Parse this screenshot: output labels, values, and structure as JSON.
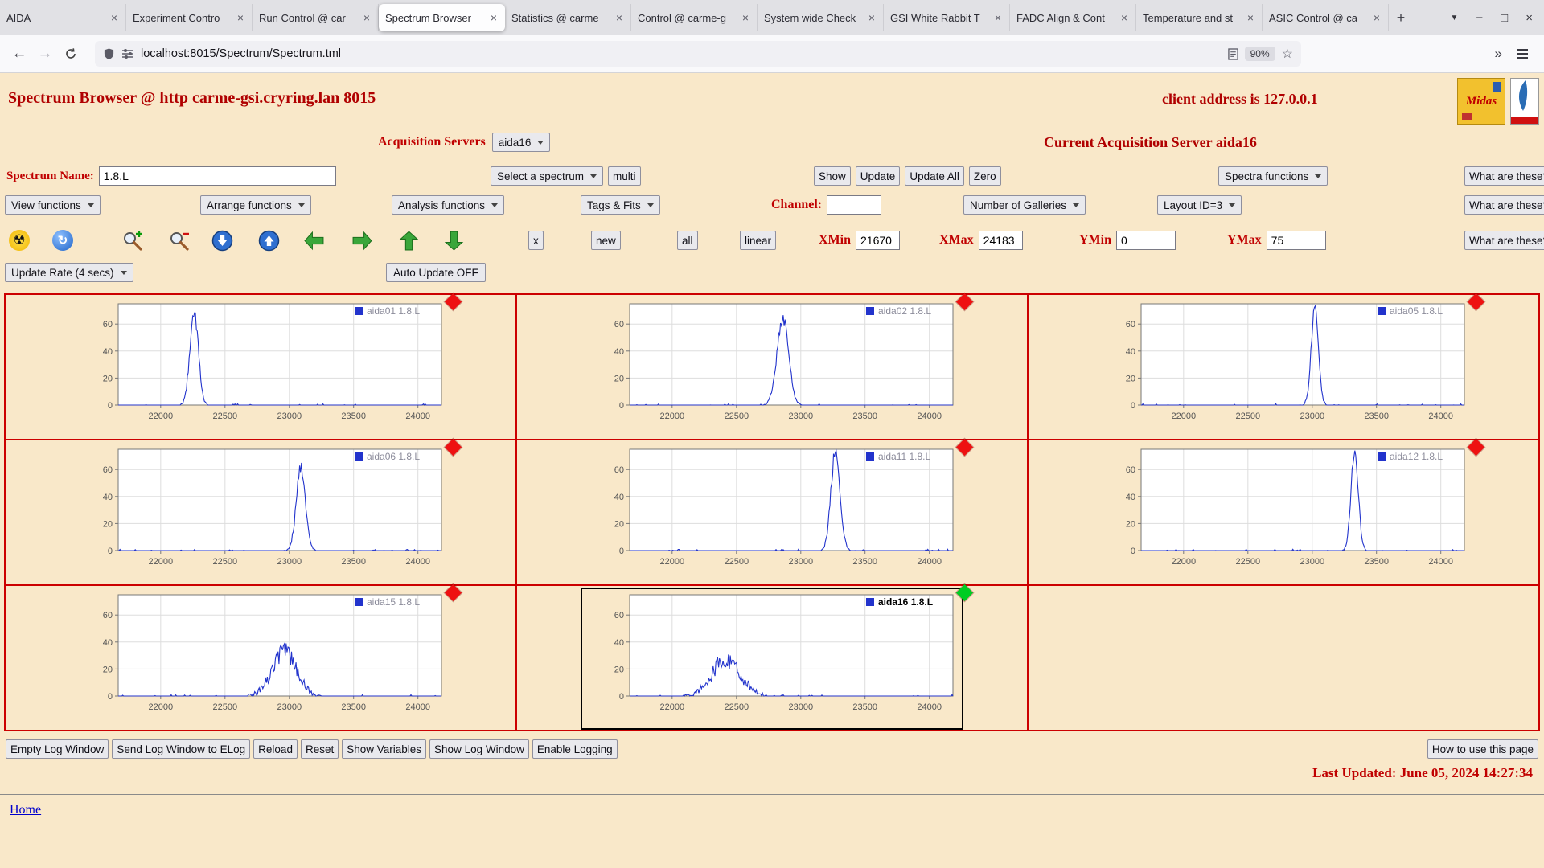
{
  "colors": {
    "accent": "#c00000",
    "page_bg": "#f9e8c9",
    "line": "#2233cc",
    "grid_border": "#cc0000",
    "marker_red": "#ee1111",
    "marker_green": "#00cc22",
    "link": "#0000cc"
  },
  "icons": {
    "radiation": "☢",
    "refresh": "↻",
    "back": "←",
    "forward": "→",
    "star": "☆",
    "overflow": "»",
    "minimize": "−",
    "maximize": "□",
    "close": "×",
    "tab_close": "×",
    "new_tab": "+",
    "tab_list": "▼"
  },
  "browser": {
    "tabs": [
      {
        "title": "AIDA"
      },
      {
        "title": "Experiment Contro"
      },
      {
        "title": "Run Control @ car"
      },
      {
        "title": "Spectrum Browser"
      },
      {
        "title": "Statistics @ carme"
      },
      {
        "title": "Control @ carme-g"
      },
      {
        "title": "System wide Check"
      },
      {
        "title": "GSI White Rabbit T"
      },
      {
        "title": "FADC Align & Cont"
      },
      {
        "title": "Temperature and st"
      },
      {
        "title": "ASIC Control @ ca"
      }
    ],
    "url": "localhost:8015/Spectrum/Spectrum.tml",
    "zoom_badge": "90%"
  },
  "header": {
    "title": "Spectrum Browser @ http carme-gsi.cryring.lan 8015",
    "client": "client address is 127.0.0.1",
    "midas_logo_text": "Midas"
  },
  "acquisition": {
    "label": "Acquisition Servers",
    "selected": "aida16",
    "current": "Current Acquisition Server aida16"
  },
  "controls": {
    "spectrum_name_label": "Spectrum Name:",
    "spectrum_name_value": "1.8.L",
    "select_spectrum": "Select a spectrum",
    "multi": "multi",
    "show": "Show",
    "update": "Update",
    "update_all": "Update All",
    "zero": "Zero",
    "spectra_functions": "Spectra functions",
    "what_are_these": "What are these?",
    "view_functions": "View functions",
    "arrange_functions": "Arrange functions",
    "analysis_functions": "Analysis functions",
    "tags_fits": "Tags & Fits",
    "channel_label": "Channel:",
    "channel_value": "",
    "galleries": "Number of Galleries",
    "layout": "Layout ID=3",
    "x_button": "x",
    "new": "new",
    "all": "all",
    "linear": "linear",
    "xmin_label": "XMin",
    "xmin": "21670",
    "xmax_label": "XMax",
    "xmax": "24183",
    "ymin_label": "YMin",
    "ymin": "0",
    "ymax_label": "YMax",
    "ymax": "75",
    "update_rate": "Update Rate (4 secs)",
    "auto_update": "Auto Update OFF"
  },
  "footer": {
    "buttons": [
      "Empty Log Window",
      "Send Log Window to ELog",
      "Reload",
      "Reset",
      "Show Variables",
      "Show Log Window",
      "Enable Logging"
    ],
    "help": "How to use this page",
    "last_updated": "Last Updated: June 05, 2024 14:27:34",
    "home": "Home"
  },
  "chart_data": {
    "type": "line",
    "xlim": [
      21670,
      24183
    ],
    "ylim": [
      0,
      75
    ],
    "x_ticks": [
      22000,
      22500,
      23000,
      23500,
      24000
    ],
    "y_ticks": [
      0,
      20,
      40,
      60
    ],
    "panels": [
      {
        "name": "aida01",
        "legend": "aida01 1.8.L",
        "marker": "red",
        "active": false,
        "peak_center": 22260,
        "peak_height": 69,
        "peak_sigma": 33,
        "jitter": 1.1
      },
      {
        "name": "aida02",
        "legend": "aida02 1.8.L",
        "marker": "red",
        "active": false,
        "peak_center": 22860,
        "peak_height": 64,
        "peak_sigma": 45,
        "jitter": 1.2
      },
      {
        "name": "aida05",
        "legend": "aida05 1.8.L",
        "marker": "red",
        "active": false,
        "peak_center": 23020,
        "peak_height": 70,
        "peak_sigma": 28,
        "jitter": 1.2
      },
      {
        "name": "aida06",
        "legend": "aida06 1.8.L",
        "marker": "red",
        "active": false,
        "peak_center": 23090,
        "peak_height": 62,
        "peak_sigma": 35,
        "jitter": 1.1
      },
      {
        "name": "aida11",
        "legend": "aida11 1.8.L",
        "marker": "red",
        "active": false,
        "peak_center": 23270,
        "peak_height": 74,
        "peak_sigma": 35,
        "jitter": 1.1
      },
      {
        "name": "aida12",
        "legend": "aida12 1.8.L",
        "marker": "red",
        "active": false,
        "peak_center": 23330,
        "peak_height": 74,
        "peak_sigma": 28,
        "jitter": 1.1
      },
      {
        "name": "aida15",
        "legend": "aida15 1.8.L",
        "marker": "red",
        "active": false,
        "peak_center": 22960,
        "peak_height": 33,
        "peak_sigma": 95,
        "jitter": 2.4
      },
      {
        "name": "aida16",
        "legend": "aida16 1.8.L",
        "marker": "green",
        "active": true,
        "peak_center": 22420,
        "peak_height": 27,
        "peak_sigma": 110,
        "jitter": 2.6
      }
    ]
  }
}
